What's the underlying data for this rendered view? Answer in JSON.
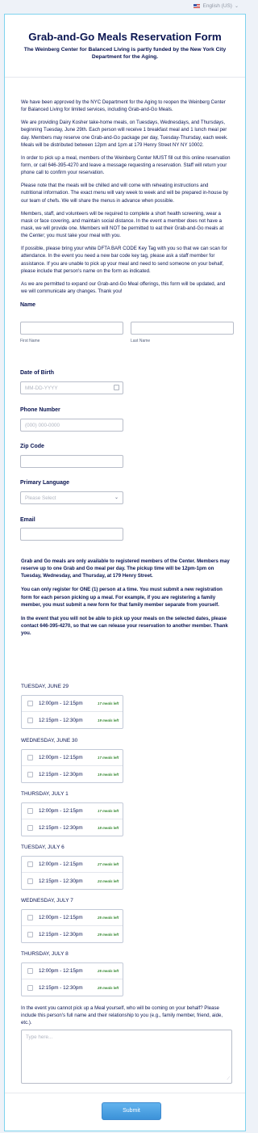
{
  "language": {
    "label": "English (US)"
  },
  "form": {
    "title": "Grab-and-Go Meals Reservation Form",
    "subtitle": "The Weinberg Center for Balanced Living is partly funded by the New York City Department for the Aging.",
    "intro": [
      "We have been approved by the NYC Department for the Aging to reopen the Weinberg Center for Balanced Living for limited services, including Grab-and-Go Meals.",
      "We are providing Dairy Kosher take-home meals, on Tuesdays, Wednesdays, and Thursdays, beginning Tuesday, June 29th. Each person will receive 1 breakfast meal and 1 lunch meal per day. Members may reserve one Grab-and-Go package per day, Tuesday-Thursday, each week. Meals will be distributed between 12pm and 1pm at 179 Henry Street NY NY 10002.",
      "In order to pick up a meal, members of the Weinberg Center MUST fill out this online reservation form, or call 646-395-4270 and leave a message requesting a reservation. Staff will return your phone call to confirm your reservation.",
      "Please note that the meals will be chilled and will come with reheating instructions and nutritional information. The exact menu will vary week to week and will be prepared in-house by our team of chefs. We will share the menus in advance when possible.",
      "Members, staff, and volunteers will be required to complete a short health screening, wear a mask or face covering, and maintain social distance. In the event a member does not have a mask, we will provide one. Members will NOT be permitted to eat their Grab-and-Go meals at the Center; you must take your meal with you.",
      "If possible, please bring your white DFTA BAR CODE Key Tag with you so that we can scan for attendance. In the event you need a new bar code key tag, please ask a staff member for assistance. If you are unable to pick up your meal and need to send someone on your behalf, please include that person's name on the form as indicated.",
      "As we are permitted to expand our Grab-and-Go Meal offerings, this form will be updated, and we will communicate any changes. Thank you!"
    ]
  },
  "fields": {
    "name": {
      "label": "Name",
      "first": "First Name",
      "last": "Last Name"
    },
    "dob": {
      "label": "Date of Birth",
      "placeholder": "MM-DD-YYYY"
    },
    "phone": {
      "label": "Phone Number",
      "placeholder": "(000) 000-0000"
    },
    "zip": {
      "label": "Zip Code"
    },
    "language": {
      "label": "Primary Language",
      "selected": "Please Select"
    },
    "email": {
      "label": "Email"
    }
  },
  "notes": [
    "Grab and Go meals are only available to registered members of the Center. Members may reserve up to one Grab and Go meal per day. The pickup time will be 12pm-1pm on Tuesday, Wednesday, and Thursday, at 179 Henry Street.",
    "You can only register for ONE (1) person at a time. You must submit a new registration form for each person picking up a meal. For example, if you are registering a family member, you must submit a new form for that family member separate from yourself.",
    "In the event that you will not be able to pick up your meals on the selected dates, please contact 646-395-4270, so that we can release your reservation to another member. Thank you."
  ],
  "days": [
    {
      "label": "TUESDAY, JUNE 29",
      "slots": [
        {
          "time": "12:00pm - 12:15pm",
          "left": "17 meals left"
        },
        {
          "time": "12:15pm - 12:30pm",
          "left": "19 meals left"
        }
      ]
    },
    {
      "label": "WEDNESDAY, JUNE 30",
      "slots": [
        {
          "time": "12:00pm - 12:15pm",
          "left": "17 meals left"
        },
        {
          "time": "12:15pm - 12:30pm",
          "left": "19 meals left"
        }
      ]
    },
    {
      "label": "THURSDAY, JULY 1",
      "slots": [
        {
          "time": "12:00pm - 12:15pm",
          "left": "17 meals left"
        },
        {
          "time": "12:15pm - 12:30pm",
          "left": "18 meals left"
        }
      ]
    },
    {
      "label": "TUESDAY, JULY 6",
      "slots": [
        {
          "time": "12:00pm - 12:15pm",
          "left": "27 meals left"
        },
        {
          "time": "12:15pm - 12:30pm",
          "left": "24 meals left"
        }
      ]
    },
    {
      "label": "WEDNESDAY, JULY 7",
      "slots": [
        {
          "time": "12:00pm - 12:15pm",
          "left": "25 meals left"
        },
        {
          "time": "12:15pm - 12:30pm",
          "left": "29 meals left"
        }
      ]
    },
    {
      "label": "THURSDAY, JULY 8",
      "slots": [
        {
          "time": "12:00pm - 12:15pm",
          "left": "25 meals left"
        },
        {
          "time": "12:15pm - 12:30pm",
          "left": "28 meals left"
        }
      ]
    }
  ],
  "pickup": {
    "question": "In the event you cannot pick up a Meal yourself, who will be coming on your behalf? Please include this person's full name and their relationship to you (e.g., family member, friend, aide, etc.).",
    "placeholder": "Type here..."
  },
  "submit": {
    "label": "Submit"
  },
  "colors": {
    "accent": "#0a1551",
    "submit": "#4aa3e6",
    "meals_left": "#3a8a36",
    "border": "#7fd3ee"
  }
}
